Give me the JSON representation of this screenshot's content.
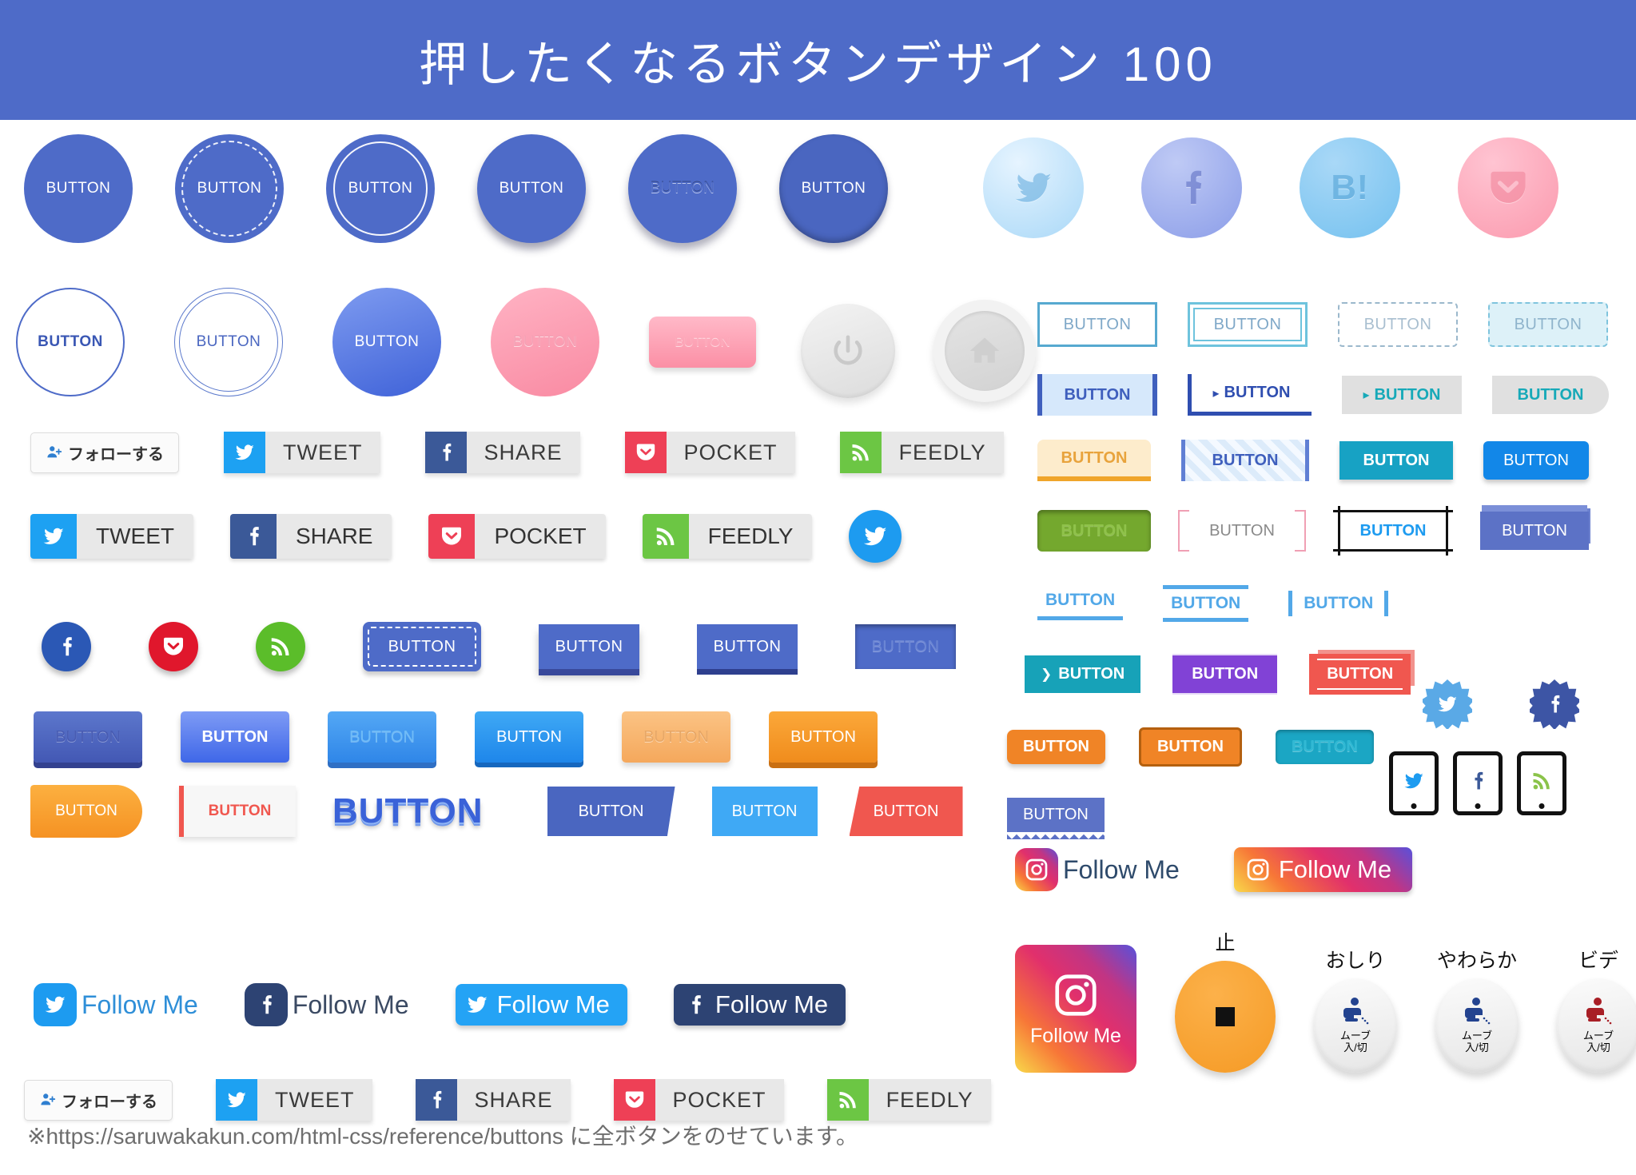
{
  "header": {
    "title": "押したくなるボタンデザイン 100",
    "bg": "#4e6bc8"
  },
  "labels": {
    "button": "BUTTON",
    "follow_me": "Follow Me",
    "follow_jp": "フォローする"
  },
  "share": {
    "tweet": "TWEET",
    "share": "SHARE",
    "pocket": "POCKET",
    "feedly": "FEEDLY"
  },
  "circles_row1": [
    {
      "label": "BUTTON",
      "style": "flat"
    },
    {
      "label": "BUTTON",
      "style": "dashed-inner-border"
    },
    {
      "label": "BUTTON",
      "style": "solid-inner-ring"
    },
    {
      "label": "BUTTON",
      "style": "drop-shadow"
    },
    {
      "label": "BUTTON",
      "style": "embossed-text"
    },
    {
      "label": "BUTTON",
      "style": "pressed-inset"
    }
  ],
  "social_pastel": [
    {
      "icon": "twitter-icon",
      "color": "#a9d8f7"
    },
    {
      "icon": "facebook-icon",
      "color": "#8b9de8"
    },
    {
      "icon": "hatena-icon",
      "label": "B!",
      "color": "#74c1ef"
    },
    {
      "icon": "pocket-icon",
      "color": "#fb9aae"
    }
  ],
  "circles_row2": [
    {
      "label": "BUTTON",
      "style": "outline-bold"
    },
    {
      "label": "BUTTON",
      "style": "double-outline"
    },
    {
      "label": "BUTTON",
      "style": "gradient-blue"
    },
    {
      "label": "BUTTON",
      "style": "gradient-pink"
    },
    {
      "label": "BUTTON",
      "style": "pink-rounded-rect"
    }
  ],
  "utility_circles": [
    {
      "icon": "power-icon"
    },
    {
      "icon": "home-icon"
    }
  ],
  "outlined_right": [
    {
      "label": "BUTTON",
      "style": "solid-border"
    },
    {
      "label": "BUTTON",
      "style": "double-border"
    },
    {
      "label": "BUTTON",
      "style": "dashed-border"
    },
    {
      "label": "BUTTON",
      "style": "dashed-border-filled"
    }
  ],
  "side_bar_right": [
    {
      "label": "BUTTON",
      "style": "left-right-bars"
    },
    {
      "label": "BUTTON",
      "style": "corner-L-arrow",
      "arrow": "▸"
    },
    {
      "label": "BUTTON",
      "style": "grey-arrow",
      "arrow": "▸"
    },
    {
      "label": "BUTTON",
      "style": "grey-rounded-right"
    }
  ],
  "varied_right_1": [
    {
      "label": "BUTTON",
      "style": "orange-underline"
    },
    {
      "label": "BUTTON",
      "style": "striped"
    },
    {
      "label": "BUTTON",
      "style": "teal-flat"
    },
    {
      "label": "BUTTON",
      "style": "blue-rounded"
    }
  ],
  "varied_right_2": [
    {
      "label": "BUTTON",
      "style": "green-inset"
    },
    {
      "label": "BUTTON",
      "style": "pink-brackets"
    },
    {
      "label": "BUTTON",
      "style": "crosshair-frame"
    },
    {
      "label": "BUTTON",
      "style": "3d-box"
    }
  ],
  "underline_right": [
    {
      "label": "BUTTON",
      "style": "underline"
    },
    {
      "label": "BUTTON",
      "style": "top-bottom-line"
    },
    {
      "label": "BUTTON",
      "style": "left-right-line"
    }
  ],
  "accent_right": [
    {
      "label": "BUTTON",
      "style": "teal-chevron",
      "arrow": "❯"
    },
    {
      "label": "BUTTON",
      "style": "purple-lines"
    },
    {
      "label": "BUTTON",
      "style": "red-offset"
    }
  ],
  "orange_right": [
    {
      "label": "BUTTON",
      "style": "orange-rounded"
    },
    {
      "label": "BUTTON",
      "style": "orange-bordered"
    },
    {
      "label": "BUTTON",
      "style": "teal-inset"
    }
  ],
  "zigzag_right": [
    {
      "label": "BUTTON",
      "style": "blue-zigzag-bottom"
    }
  ],
  "social_solid": [
    {
      "icon": "facebook-icon",
      "color": "#2b58b5"
    },
    {
      "icon": "pocket-icon",
      "color": "#e0172c"
    },
    {
      "icon": "feedly-icon",
      "color": "#5bbd2a"
    }
  ],
  "rect_blue": [
    {
      "label": "BUTTON",
      "style": "dashed-inner"
    },
    {
      "label": "BUTTON",
      "style": "3d-shadow"
    },
    {
      "label": "BUTTON",
      "style": "3d-solid"
    },
    {
      "label": "BUTTON",
      "style": "inset-text"
    }
  ],
  "gradient_row": [
    {
      "label": "BUTTON",
      "style": "indigo-3d"
    },
    {
      "label": "BUTTON",
      "style": "blue-gradient-bold"
    },
    {
      "label": "BUTTON",
      "style": "sky-3d"
    },
    {
      "label": "BUTTON",
      "style": "sky-3d-white"
    },
    {
      "label": "BUTTON",
      "style": "peach-gradient"
    },
    {
      "label": "BUTTON",
      "style": "orange-3d"
    }
  ],
  "shape_row": [
    {
      "label": "BUTTON",
      "style": "orange-pill-right"
    },
    {
      "label": "BUTTON",
      "style": "white-red-bar"
    },
    {
      "label": "BUTTON",
      "style": "3d-text-extruded"
    },
    {
      "label": "BUTTON",
      "style": "indigo-skew"
    },
    {
      "label": "BUTTON",
      "style": "sky-flat"
    },
    {
      "label": "BUTTON",
      "style": "red-skew"
    }
  ],
  "follow_buttons": [
    {
      "label": "Follow Me",
      "icon": "twitter-icon",
      "style": "icon-left-light",
      "color": "#1d9bf0"
    },
    {
      "label": "Follow Me",
      "icon": "facebook-icon",
      "style": "icon-left-dark",
      "color": "#2d4373"
    },
    {
      "label": "Follow Me",
      "icon": "twitter-icon",
      "style": "filled-blue",
      "color": "#1d9bf0"
    },
    {
      "label": "Follow Me",
      "icon": "facebook-icon",
      "style": "filled-navy",
      "color": "#2d4373"
    }
  ],
  "instagram": [
    {
      "label": "Follow Me",
      "style": "icon-left"
    },
    {
      "label": "Follow Me",
      "style": "gradient-pill"
    },
    {
      "label": "Follow Me",
      "style": "gradient-card"
    }
  ],
  "badges": [
    {
      "icon": "twitter-icon",
      "style": "starburst",
      "color": "#5aa9e6"
    },
    {
      "icon": "facebook-icon",
      "style": "starburst",
      "color": "#3d55a5"
    }
  ],
  "tablets": [
    {
      "icon": "twitter-icon",
      "color": "#1d9bf0"
    },
    {
      "icon": "facebook-icon",
      "color": "#3b5998"
    },
    {
      "icon": "feedly-icon",
      "color": "#8bc34a"
    }
  ],
  "washlet": [
    {
      "caption": "止",
      "style": "orange-stop",
      "sub": ""
    },
    {
      "caption": "おしり",
      "style": "white-blue",
      "sub": "ムーブ\n入/切"
    },
    {
      "caption": "やわらか",
      "style": "white-blue",
      "sub": "ムーブ\n入/切"
    },
    {
      "caption": "ビデ",
      "style": "white-red",
      "sub": "ムーブ\n入/切"
    }
  ],
  "washlet_sub_line1": "ムーブ",
  "washlet_sub_line2": "入/切",
  "footnote": "※https://saruwakakun.com/html-css/reference/buttons に全ボタンをのせています。"
}
